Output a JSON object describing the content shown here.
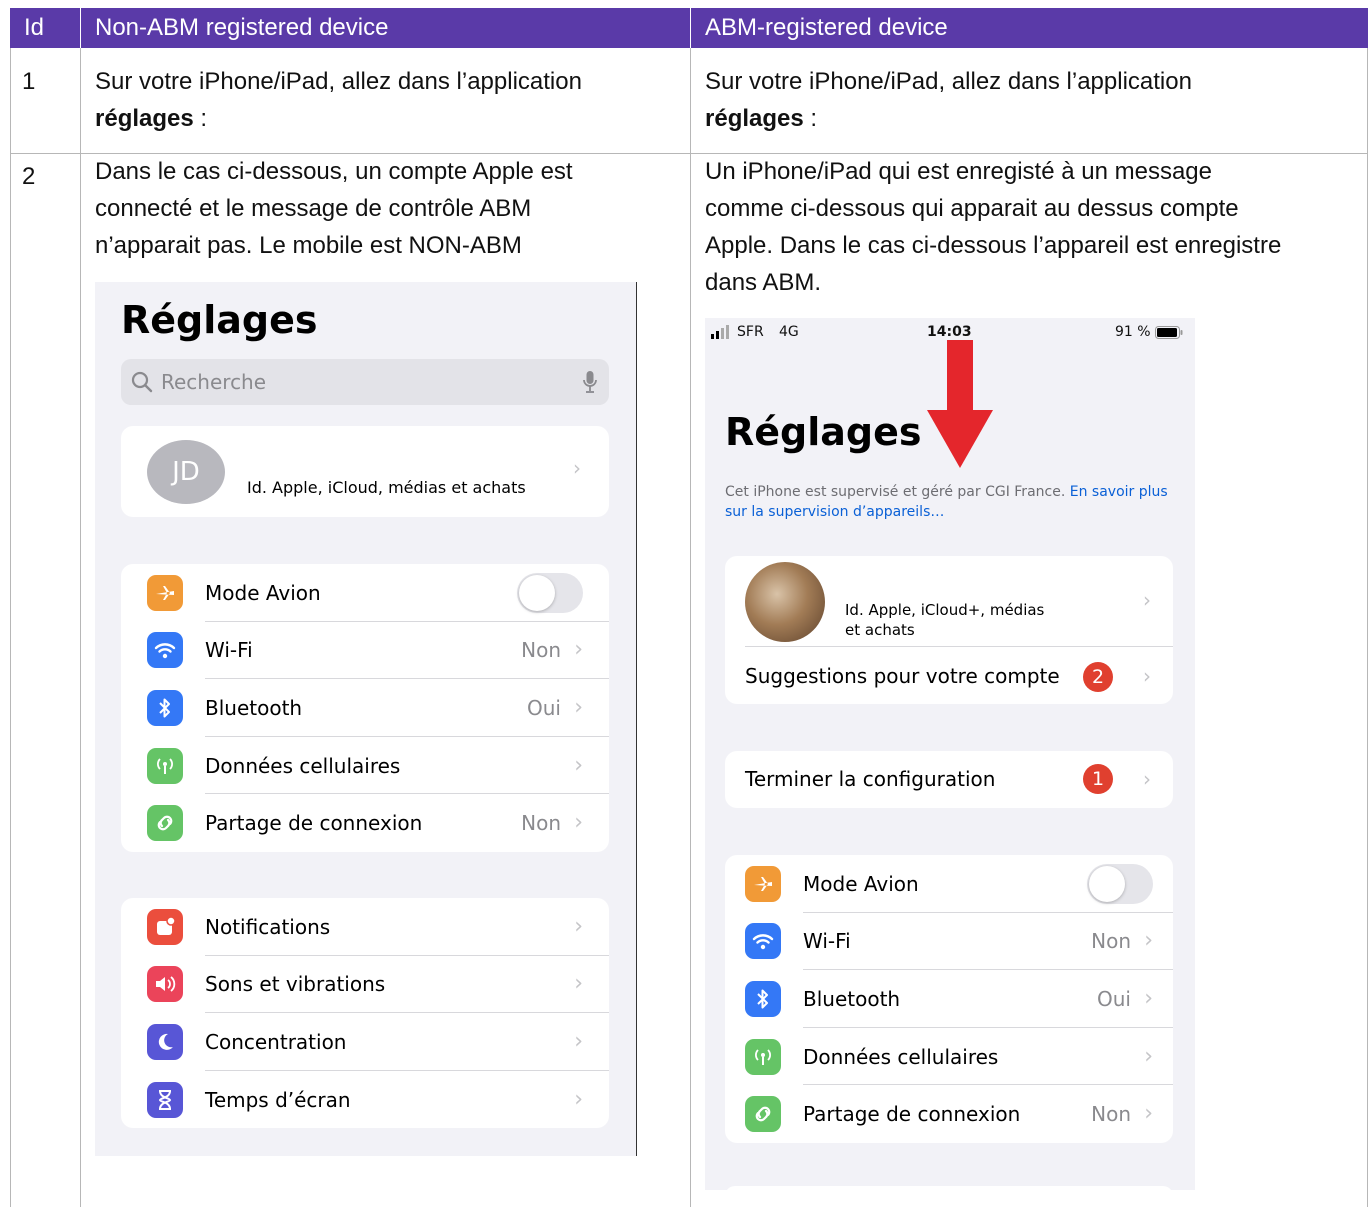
{
  "table": {
    "headers": {
      "id": "Id",
      "non_abm": "Non-ABM registered device",
      "abm": "ABM-registered device"
    },
    "rows": [
      {
        "id": "1",
        "non_abm": {
          "line1": "Sur votre iPhone/iPad, allez dans l’application",
          "bold": "réglages",
          "suffix": " :"
        },
        "abm": {
          "line1": "Sur votre iPhone/iPad, allez dans l’application",
          "bold": "réglages",
          "suffix": " :"
        }
      },
      {
        "id": "2",
        "non_abm": [
          "Dans le cas ci-dessous, un compte Apple est",
          "connecté et le message de contrôle ABM",
          "n’apparait pas. Le mobile est NON-ABM"
        ],
        "abm": [
          "Un iPhone/iPad qui est enregisté à un message",
          "comme ci-dessous qui apparait au dessus compte",
          "Apple. Dans le cas ci-dessous l’appareil est enregistre",
          "dans ABM."
        ]
      }
    ]
  },
  "screenshot_left": {
    "title": "Réglages",
    "search_placeholder": "Recherche",
    "avatar_initials": "JD",
    "account_label": "Id. Apple, iCloud, médias et achats",
    "group1": [
      {
        "icon": "airplane-icon",
        "color": "#f19a37",
        "label": "Mode Avion",
        "value": "",
        "control": "toggle"
      },
      {
        "icon": "wifi-icon",
        "color": "#3478f6",
        "label": "Wi-Fi",
        "value": "Non"
      },
      {
        "icon": "bluetooth-icon",
        "color": "#3478f6",
        "label": "Bluetooth",
        "value": "Oui"
      },
      {
        "icon": "cellular-icon",
        "color": "#65c466",
        "label": "Données cellulaires",
        "value": ""
      },
      {
        "icon": "hotspot-icon",
        "color": "#65c466",
        "label": "Partage de connexion",
        "value": "Non"
      }
    ],
    "group2": [
      {
        "icon": "notifications-icon",
        "color": "#eb4e3d",
        "label": "Notifications",
        "value": ""
      },
      {
        "icon": "sounds-icon",
        "color": "#eb445a",
        "label": "Sons et vibrations",
        "value": ""
      },
      {
        "icon": "focus-icon",
        "color": "#5856d6",
        "label": "Concentration",
        "value": ""
      },
      {
        "icon": "hourglass-icon",
        "color": "#5856d6",
        "label": "Temps d’écran",
        "value": ""
      }
    ]
  },
  "screenshot_right": {
    "status": {
      "carrier": "SFR",
      "network": "4G",
      "time": "14:03",
      "battery": "91 %"
    },
    "title": "Réglages",
    "supervision_text": "Cet iPhone est supervisé et géré par CGI France.",
    "supervision_link_1": "En",
    "supervision_link_2": "savoir plus sur la supervision d’appareils…",
    "account_line1": "Id. Apple, iCloud+, médias",
    "account_line2": "et achats",
    "suggestions_label": "Suggestions pour votre compte",
    "suggestions_badge": "2",
    "setup_label": "Terminer la configuration",
    "setup_badge": "1",
    "group1": [
      {
        "icon": "airplane-icon",
        "color": "#f19a37",
        "label": "Mode Avion",
        "value": "",
        "control": "toggle"
      },
      {
        "icon": "wifi-icon",
        "color": "#3478f6",
        "label": "Wi-Fi",
        "value": "Non"
      },
      {
        "icon": "bluetooth-icon",
        "color": "#3478f6",
        "label": "Bluetooth",
        "value": "Oui"
      },
      {
        "icon": "cellular-icon",
        "color": "#65c466",
        "label": "Données cellulaires",
        "value": ""
      },
      {
        "icon": "hotspot-icon",
        "color": "#65c466",
        "label": "Partage de connexion",
        "value": "Non"
      }
    ]
  },
  "colors": {
    "header_bg": "#5a3aa8",
    "arrow": "#e4262c",
    "ios_link": "#0a60d6"
  }
}
